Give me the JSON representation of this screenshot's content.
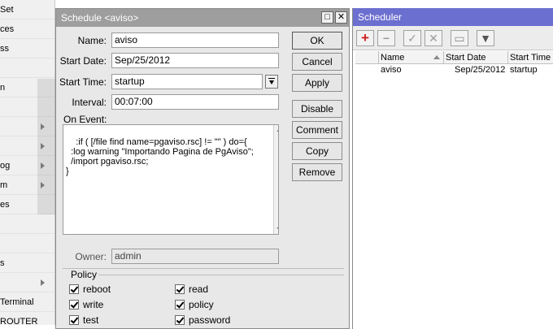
{
  "leftmenu": {
    "items": [
      {
        "label": "Set",
        "arrow": false
      },
      {
        "label": "ces",
        "arrow": false
      },
      {
        "label": "ss",
        "arrow": false
      },
      {
        "label": "",
        "arrow": false
      },
      {
        "label": "n",
        "arrow": false
      },
      {
        "label": "",
        "arrow": false
      },
      {
        "label": "",
        "arrow": true
      },
      {
        "label": "",
        "arrow": true
      },
      {
        "label": "og",
        "arrow": true
      },
      {
        "label": "m",
        "arrow": true
      },
      {
        "label": "es",
        "arrow": false
      },
      {
        "label": "",
        "arrow": false
      },
      {
        "label": "",
        "arrow": false
      },
      {
        "label": "s",
        "arrow": false
      },
      {
        "label": "",
        "arrow": true
      },
      {
        "label": "Terminal",
        "arrow": false
      },
      {
        "label": "ROUTER",
        "arrow": false
      }
    ]
  },
  "dialog": {
    "title": "Schedule <aviso>",
    "minimize_glyph": "□",
    "close_glyph": "✕",
    "name_label": "Name:",
    "name_value": "aviso",
    "start_date_label": "Start Date:",
    "start_date_value": "Sep/25/2012",
    "start_time_label": "Start Time:",
    "start_time_value": "startup",
    "interval_label": "Interval:",
    "interval_value": "00:07:00",
    "on_event_label": "On Event:",
    "script": ":if ( [/file find name=pgaviso.rsc] != \"\" ) do={\n  :log warning \"Importando Pagina de PgAviso\";\n  /import pgaviso.rsc;\n}",
    "owner_label": "Owner:",
    "owner_value": "admin",
    "policy_label": "Policy",
    "policies_left": [
      "reboot",
      "write",
      "test"
    ],
    "policies_right": [
      "read",
      "policy",
      "password"
    ],
    "buttons": {
      "ok": "OK",
      "cancel": "Cancel",
      "apply": "Apply",
      "disable": "Disable",
      "comment": "Comment",
      "copy": "Copy",
      "remove": "Remove"
    }
  },
  "scheduler": {
    "title": "Scheduler",
    "toolbar": {
      "add": "+",
      "remove": "−",
      "enable": "✓",
      "disable": "✕",
      "comment": "▭",
      "filter": "▼"
    },
    "columns": [
      "Name",
      "Start Date",
      "Start Time"
    ],
    "rows": [
      {
        "name": "aviso",
        "start_date": "Sep/25/2012",
        "start_time": "startup"
      }
    ]
  },
  "colors": {
    "dialog_title_bg": "#9e9e9e",
    "scheduler_title_bg": "#6b6fcf",
    "add_icon": "#d32020"
  }
}
